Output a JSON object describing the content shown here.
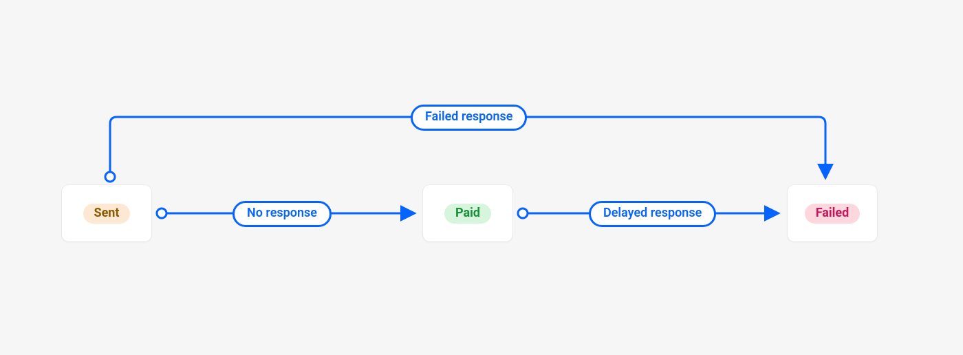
{
  "states": {
    "sent": {
      "label": "Sent"
    },
    "paid": {
      "label": "Paid"
    },
    "failed": {
      "label": "Failed"
    }
  },
  "transitions": {
    "no_response": {
      "label": "No response"
    },
    "delayed_response": {
      "label": "Delayed response"
    },
    "failed_response": {
      "label": "Failed response"
    }
  },
  "colors": {
    "edge": "#0563ff"
  }
}
